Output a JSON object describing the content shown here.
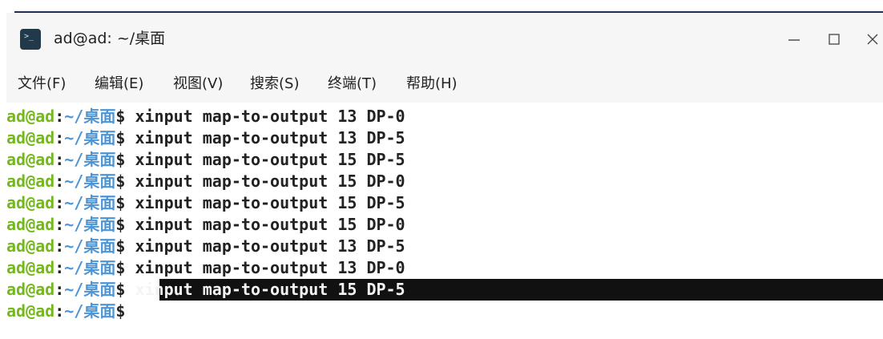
{
  "window": {
    "title": "ad@ad: ~/桌面",
    "icon": "terminal-app-icon",
    "controls": [
      {
        "name": "minimize",
        "glyph": "minimize-icon"
      },
      {
        "name": "maximize",
        "glyph": "maximize-icon"
      },
      {
        "name": "close",
        "glyph": "close-icon"
      }
    ]
  },
  "menu": {
    "items": [
      {
        "label": "文件(F)"
      },
      {
        "label": "编辑(E)"
      },
      {
        "label": "视图(V)"
      },
      {
        "label": "搜索(S)"
      },
      {
        "label": "终端(T)"
      },
      {
        "label": "帮助(H)"
      }
    ]
  },
  "terminal": {
    "prompt": {
      "user": "ad@ad",
      "separator": ":",
      "path": "~/桌面",
      "symbol": "$"
    },
    "lines": [
      {
        "command": "xinput map-to-output 13 DP-0",
        "selected": false
      },
      {
        "command": "xinput map-to-output 13 DP-5",
        "selected": false
      },
      {
        "command": "xinput map-to-output 15 DP-5",
        "selected": false
      },
      {
        "command": "xinput map-to-output 15 DP-0",
        "selected": false
      },
      {
        "command": "xinput map-to-output 15 DP-5",
        "selected": false
      },
      {
        "command": "xinput map-to-output 15 DP-0",
        "selected": false
      },
      {
        "command": "xinput map-to-output 13 DP-5",
        "selected": false
      },
      {
        "command": "xinput map-to-output 13 DP-0",
        "selected": false
      },
      {
        "command": "xinput map-to-output 15 DP-5",
        "selected": true
      },
      {
        "command": "",
        "selected": false
      }
    ]
  },
  "colors": {
    "prompt_user": "#74b81e",
    "prompt_path": "#4d95d4",
    "selection_background": "#111111",
    "selection_text": "#f4f4f4"
  }
}
